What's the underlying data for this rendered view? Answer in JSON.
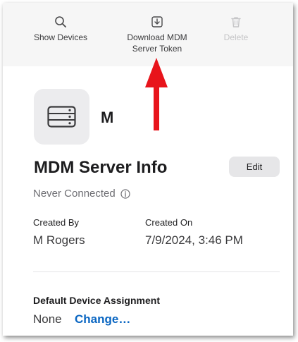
{
  "toolbar": {
    "show_devices_label": "Show Devices",
    "download_token_label_line1": "Download MDM",
    "download_token_label_line2": "Server Token",
    "delete_label": "Delete"
  },
  "server": {
    "icon": "server-icon",
    "name": "M"
  },
  "info": {
    "title": "MDM Server Info",
    "edit_label": "Edit",
    "status": "Never Connected",
    "created_by_label": "Created By",
    "created_by_value": "M Rogers",
    "created_on_label": "Created On",
    "created_on_value": "7/9/2024, 3:46 PM"
  },
  "assignment": {
    "label": "Default Device Assignment",
    "value": "None",
    "change_label": "Change…"
  },
  "colors": {
    "link": "#0a66c2",
    "arrow": "#e8141b",
    "disabled": "#c4c4c6"
  }
}
